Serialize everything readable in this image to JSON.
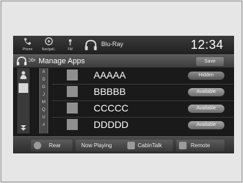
{
  "status": {
    "phone_label": "Phone",
    "navigation_label": "Navigati..",
    "fm_label": "FM",
    "source_label": "Blu-Ray",
    "clock": "12:34"
  },
  "title": {
    "chevrons": ">>",
    "text": "Manage Apps",
    "save_label": "Save"
  },
  "alpha_index": [
    "A",
    "D",
    "G",
    "J",
    "M",
    "Q",
    "U",
    "#"
  ],
  "apps": [
    {
      "name": "AAAAA",
      "status": "Hidden"
    },
    {
      "name": "BBBBB",
      "status": "Available"
    },
    {
      "name": "CCCCC",
      "status": "Available"
    },
    {
      "name": "DDDDD",
      "status": "Available"
    }
  ],
  "bottom": {
    "rear_label": "Rear",
    "now_playing_label": "Now Playing",
    "cabintalk_label": "CabinTalk",
    "remote_label": "Remote"
  },
  "colors": {
    "screen_bg": "#1a1a1a",
    "pill": "#8a8a8a",
    "text": "#ffffff"
  }
}
